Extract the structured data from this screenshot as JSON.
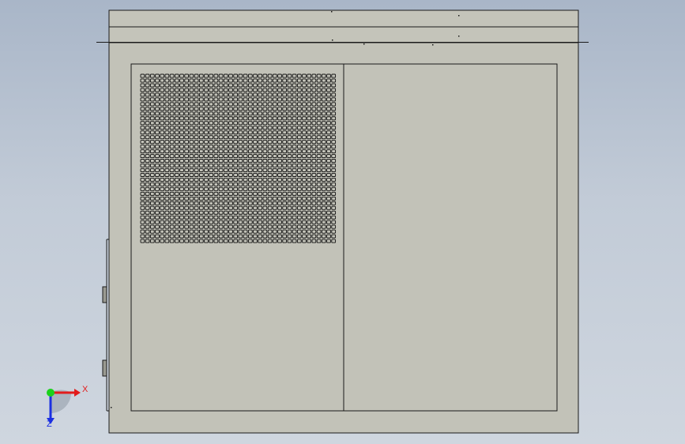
{
  "viewport": {
    "background_top": "#a9b6c8",
    "background_bottom": "#cfd6df",
    "model_fill": "#c2c2b8",
    "edge_color": "#1a1a1a"
  },
  "model": {
    "vent_grid": {
      "rows": 36,
      "cols": 40
    }
  },
  "triad": {
    "x_label": "X",
    "z_label": "Z",
    "x_color": "#e21b1b",
    "y_color": "#1bd21b",
    "z_color": "#1b2fe2"
  }
}
